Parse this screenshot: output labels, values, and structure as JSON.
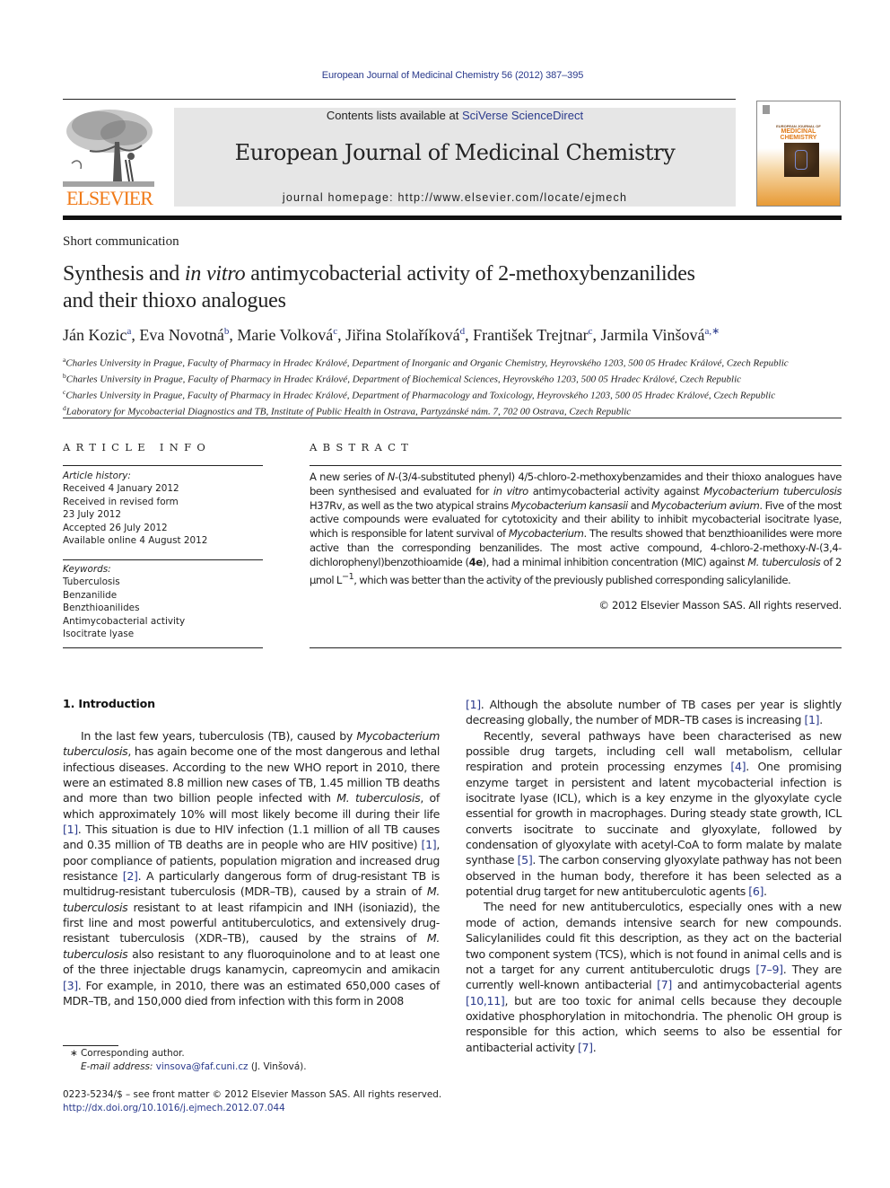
{
  "citation": "European Journal of Medicinal Chemistry 56 (2012) 387–395",
  "masthead": {
    "contents_prefix": "Contents lists available at ",
    "contents_link": "SciVerse ScienceDirect",
    "journal_title": "European Journal of Medicinal Chemistry",
    "homepage_label": "journal homepage: ",
    "homepage_url": "http://www.elsevier.com/locate/ejmech",
    "publisher_wordmark": "ELSEVIER",
    "cover": {
      "title_line1": "EUROPEAN JOURNAL OF",
      "title_line2": "MEDICINAL",
      "title_line3": "CHEMISTRY"
    }
  },
  "colors": {
    "link": "#2a3a8c",
    "elsevier_orange": "#f07a18",
    "masthead_bg": "#e6e6e6"
  },
  "article": {
    "type": "Short communication",
    "title_part1": "Synthesis and ",
    "title_italic": "in vitro",
    "title_part2": " antimycobacterial activity of 2-methoxybenzanilides",
    "title_line2": "and their thioxo analogues",
    "authors": [
      {
        "name": "Ján Kozic",
        "sup": "a",
        "sep": ", "
      },
      {
        "name": "Eva Novotná",
        "sup": "b",
        "sep": ", "
      },
      {
        "name": "Marie Volková",
        "sup": "c",
        "sep": ", "
      },
      {
        "name": "Jiřina Stolaříková",
        "sup": "d",
        "sep": ", "
      },
      {
        "name": "František Trejtnar",
        "sup": "c",
        "sep": ", "
      },
      {
        "name": "Jarmila Vinšová",
        "sup": "a,∗",
        "sep": ""
      }
    ],
    "affiliations": [
      {
        "key": "a",
        "text": "Charles University in Prague, Faculty of Pharmacy in Hradec Králové, Department of Inorganic and Organic Chemistry, Heyrovského 1203, 500 05 Hradec Králové, Czech Republic"
      },
      {
        "key": "b",
        "text": "Charles University in Prague, Faculty of Pharmacy in Hradec Králové, Department of Biochemical Sciences, Heyrovského 1203, 500 05 Hradec Králové, Czech Republic"
      },
      {
        "key": "c",
        "text": "Charles University in Prague, Faculty of Pharmacy in Hradec Králové, Department of Pharmacology and Toxicology, Heyrovského 1203, 500 05 Hradec Králové, Czech Republic"
      },
      {
        "key": "d",
        "text": "Laboratory for Mycobacterial Diagnostics and TB, Institute of Public Health in Ostrava, Partyzánské nám. 7, 702 00 Ostrava, Czech Republic"
      }
    ]
  },
  "article_info": {
    "heading": "ARTICLE INFO",
    "history_label": "Article history:",
    "history": [
      "Received 4 January 2012",
      "Received in revised form",
      "23 July 2012",
      "Accepted 26 July 2012",
      "Available online 4 August 2012"
    ],
    "keywords_label": "Keywords:",
    "keywords": [
      "Tuberculosis",
      "Benzanilide",
      "Benzthioanilides",
      "Antimycobacterial activity",
      "Isocitrate lyase"
    ]
  },
  "abstract": {
    "heading": "ABSTRACT",
    "segments": [
      {
        "t": "A new series of "
      },
      {
        "t": "N",
        "i": true
      },
      {
        "t": "-(3/4-substituted phenyl) 4/5-chloro-2-methoxybenzamides and their thioxo analogues have been synthesised and evaluated for "
      },
      {
        "t": "in vitro",
        "i": true
      },
      {
        "t": " antimycobacterial activity against "
      },
      {
        "t": "Mycobacterium tuberculosis",
        "i": true
      },
      {
        "t": " H37Rv, as well as the two atypical strains "
      },
      {
        "t": "Mycobacterium kansasii",
        "i": true
      },
      {
        "t": " and "
      },
      {
        "t": "Mycobacterium avium",
        "i": true
      },
      {
        "t": ". Five of the most active compounds were evaluated for cytotoxicity and their ability to inhibit myco­bacterial isocitrate lyase, which is responsible for latent survival of "
      },
      {
        "t": "Mycobacterium",
        "i": true
      },
      {
        "t": ". The results showed that benzthioanilides were more active than the corresponding benzanilides. The most active compound, 4-chloro-2-methoxy-"
      },
      {
        "t": "N",
        "i": true
      },
      {
        "t": "-(3,4-dichlorophenyl)benzothioamide ("
      },
      {
        "t": "4e",
        "b": true
      },
      {
        "t": "), had a minimal inhibition concentra­tion (MIC) against "
      },
      {
        "t": "M. tuberculosis",
        "i": true
      },
      {
        "t": " of 2 μmol L"
      },
      {
        "t": "−1",
        "sup": true
      },
      {
        "t": ", which was better than the activity of the previously published corresponding salicylanilide."
      }
    ],
    "copyright": "© 2012 Elsevier Masson SAS. All rights reserved."
  },
  "introduction": {
    "heading": "1.  Introduction",
    "left_column": [
      {
        "indent": true,
        "segments": [
          {
            "t": "In the last few years, tuberculosis (TB), caused by "
          },
          {
            "t": "Mycobacterium tuberculosis",
            "i": true
          },
          {
            "t": ", has again become one of the most dangerous and lethal infectious diseases. According to the new WHO report in 2010, there were an estimated 8.8 million new cases of TB, 1.45 million TB deaths and more than two billion people infected with "
          },
          {
            "t": "M. tuberculosis",
            "i": true
          },
          {
            "t": ", of which approximately 10% will most likely become ill during their life "
          },
          {
            "t": "[1]",
            "ref": true
          },
          {
            "t": ". This situation is due to HIV infection (1.1 million of all TB causes and 0.35 million of TB deaths are in people who are HIV positive) "
          },
          {
            "t": "[1]",
            "ref": true
          },
          {
            "t": ", poor compliance of patients, population migration and increased drug resistance "
          },
          {
            "t": "[2]",
            "ref": true
          },
          {
            "t": ". A partic­ularly dangerous form of drug-resistant TB is multidrug-resistant tuberculosis (MDR–TB), caused by a strain of "
          },
          {
            "t": "M. tuberculosis",
            "i": true
          },
          {
            "t": " resistant to at least rifampicin and INH (isoniazid), the first line and most powerful antituberculotics, and extensively drug-resistant tuberculosis (XDR–TB), caused by the strains of "
          },
          {
            "t": "M. tuberculosis",
            "i": true
          },
          {
            "t": " also resistant to any fluoroquinolone and to at least one of the three injectable drugs kanamycin, capreomycin and amikacin "
          },
          {
            "t": "[3]",
            "ref": true
          },
          {
            "t": ". For example, in 2010, there was an estimated 650,000 cases of MDR–TB, and 150,000 died from infection with this form in 2008"
          }
        ]
      }
    ],
    "right_column": [
      {
        "indent": false,
        "segments": [
          {
            "t": "[1]",
            "ref": true
          },
          {
            "t": ". Although the absolute number of TB cases per year is slightly decreasing globally, the number of MDR–TB cases is increasing "
          },
          {
            "t": "[1]",
            "ref": true
          },
          {
            "t": "."
          }
        ]
      },
      {
        "indent": true,
        "segments": [
          {
            "t": "Recently, several pathways have been characterised as new possible drug targets, including cell wall metabolism, cellular respiration and protein processing enzymes "
          },
          {
            "t": "[4]",
            "ref": true
          },
          {
            "t": ". One promising enzyme target in persistent and latent mycobacterial infection is isocitrate lyase (ICL), which is a key enzyme in the glyoxylate cycle essential for growth in macrophages. During steady state growth, ICL converts isocitrate to succinate and glyoxylate, followed by condensation of glyoxylate with acetyl-CoA to form malate by malate synthase "
          },
          {
            "t": "[5]",
            "ref": true
          },
          {
            "t": ". The carbon conserving glyoxylate pathway has not been observed in the human body, therefore it has been selected as a potential drug target for new antituberculotic agents "
          },
          {
            "t": "[6]",
            "ref": true
          },
          {
            "t": "."
          }
        ]
      },
      {
        "indent": true,
        "segments": [
          {
            "t": "The need for new antituberculotics, especially ones with a new mode of action, demands intensive search for new compounds. Salicylanilides could fit this description, as they act on the bacterial two component system (TCS), which is not found in animal cells and is not a target for any current antituberculotic drugs "
          },
          {
            "t": "[7–9]",
            "ref": true
          },
          {
            "t": ". They are currently well-known antibacterial "
          },
          {
            "t": "[7]",
            "ref": true
          },
          {
            "t": " and anti­mycobacterial agents "
          },
          {
            "t": "[10,11]",
            "ref": true
          },
          {
            "t": ", but are too toxic for animal cells because they decouple oxidative phosphorylation in mitochondria. The phenolic OH group is responsible for this action, which seems to also be essential for antibacterial activity "
          },
          {
            "t": "[7]",
            "ref": true
          },
          {
            "t": "."
          }
        ]
      }
    ]
  },
  "footnotes": {
    "corresponding_marker": "∗",
    "corresponding_text": " Corresponding author.",
    "email_label": "E-mail address: ",
    "email": "vinsova@faf.cuni.cz",
    "email_suffix": " (J. Vinšová).",
    "front_matter": "0223-5234/$ – see front matter © 2012 Elsevier Masson SAS. All rights reserved.",
    "doi": "http://dx.doi.org/10.1016/j.ejmech.2012.07.044"
  }
}
